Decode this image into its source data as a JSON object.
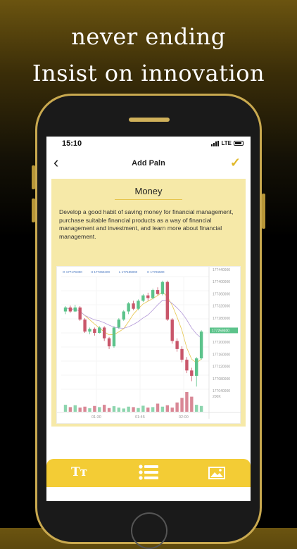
{
  "headline": {
    "line1": "never ending",
    "line2": "Insist on innovation"
  },
  "status_bar": {
    "time": "15:10",
    "network": "LTE"
  },
  "nav": {
    "title": "Add Paln"
  },
  "card": {
    "title": "Money",
    "body": "Develop a good habit of saving money for financial management, purchase suitable financial products as a way of financial management and investment, and learn more about financial management."
  },
  "chart": {
    "legend": [
      "O 17717S300",
      "H 177269400",
      "L 177185000",
      "C 17726500"
    ],
    "price_labels": [
      "177440000",
      "177400000",
      "177360000",
      "177320000",
      "177280000",
      "177240000",
      "177200000",
      "177160000",
      "177120000",
      "177080000",
      "177040000"
    ],
    "current_price": "177259400",
    "volume_label": "200K",
    "time_labels": [
      "01:30",
      "01:45",
      "02:00"
    ]
  },
  "chart_data": {
    "type": "candlestick",
    "title": "",
    "y_range": [
      177040000,
      177460000
    ],
    "candles": [
      [
        177330,
        177345,
        177320,
        177350,
        "up"
      ],
      [
        177345,
        177330,
        177325,
        177352,
        "down"
      ],
      [
        177330,
        177345,
        177328,
        177355,
        "up"
      ],
      [
        177345,
        177300,
        177295,
        177350,
        "down"
      ],
      [
        177300,
        177255,
        177250,
        177305,
        "down"
      ],
      [
        177255,
        177265,
        177245,
        177270,
        "up"
      ],
      [
        177265,
        177250,
        177240,
        177270,
        "down"
      ],
      [
        177250,
        177270,
        177248,
        177275,
        "up"
      ],
      [
        177270,
        177230,
        177220,
        177275,
        "down"
      ],
      [
        177230,
        177200,
        177190,
        177235,
        "down"
      ],
      [
        177200,
        177270,
        177195,
        177275,
        "up"
      ],
      [
        177270,
        177300,
        177265,
        177305,
        "up"
      ],
      [
        177300,
        177330,
        177295,
        177335,
        "up"
      ],
      [
        177330,
        177360,
        177320,
        177365,
        "up"
      ],
      [
        177360,
        177340,
        177335,
        177370,
        "down"
      ],
      [
        177340,
        177370,
        177335,
        177375,
        "up"
      ],
      [
        177370,
        177390,
        177365,
        177395,
        "up"
      ],
      [
        177390,
        177380,
        177370,
        177400,
        "down"
      ],
      [
        177380,
        177410,
        177375,
        177415,
        "up"
      ],
      [
        177410,
        177395,
        177390,
        177420,
        "down"
      ],
      [
        177395,
        177440,
        177390,
        177445,
        "up"
      ],
      [
        177440,
        177300,
        177295,
        177445,
        "down"
      ],
      [
        177300,
        177220,
        177210,
        177305,
        "down"
      ],
      [
        177220,
        177190,
        177180,
        177230,
        "down"
      ],
      [
        177190,
        177150,
        177140,
        177200,
        "down"
      ],
      [
        177150,
        177110,
        177100,
        177160,
        "down"
      ],
      [
        177110,
        177090,
        177070,
        177120,
        "down"
      ],
      [
        177090,
        177155,
        177050,
        177160,
        "up"
      ],
      [
        177155,
        177255,
        177150,
        177260,
        "up"
      ]
    ],
    "volumes": [
      30,
      20,
      28,
      18,
      22,
      15,
      25,
      20,
      30,
      16,
      24,
      18,
      14,
      22,
      20,
      16,
      26,
      18,
      20,
      35,
      22,
      28,
      18,
      40,
      60,
      85,
      65,
      30,
      25
    ]
  },
  "colors": {
    "accent": "#f3cc35",
    "card_bg": "#f6e9a8",
    "up": "#5cc38b",
    "down": "#c9566a"
  },
  "toolbar": {
    "text_icon_label": "Tт"
  }
}
